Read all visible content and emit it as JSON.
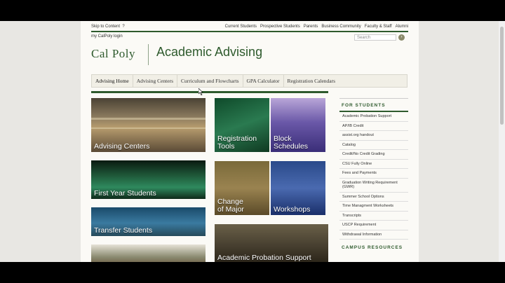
{
  "utility": {
    "skip": "Skip to Content",
    "skip_marker": "?",
    "links": [
      "Current Students",
      "Prospective Students",
      "Parents",
      "Business Community",
      "Faculty & Staff",
      "Alumni"
    ]
  },
  "login": "my CalPoly login",
  "search_placeholder": "Search",
  "logo": "Cal Poly",
  "site_title": "Academic Advising",
  "nav": [
    "Advising Home",
    "Advising Centers",
    "Curriculum and Flowcharts",
    "GPA Calculator",
    "Registration Calendars"
  ],
  "tiles": {
    "advising_centers": "Advising Centers",
    "first_year": "First Year Students",
    "transfer": "Transfer Students",
    "registration_tools_1": "Registration",
    "registration_tools_2": "Tools",
    "block_schedules_1": "Block",
    "block_schedules_2": "Schedules",
    "change_major_1": "Change",
    "change_major_2": "of Major",
    "workshops": "Workshops",
    "probation": "Academic Probation Support"
  },
  "sidebar": {
    "heading": "FOR STUDENTS",
    "items": [
      "Academic Probation Support",
      "AP/IB Credit",
      "assist.org handout",
      "Catalog",
      "Credit/No Credit Grading",
      "CSU Fully Online",
      "Fees and Payments",
      "Graduation Writing Requirement (GWR)",
      "Summer School Options",
      "Time Managment Worksheets",
      "Transcripts",
      "USCP Requirement",
      "Withdrawal Information"
    ],
    "heading2": "CAMPUS RESOURCES"
  },
  "colors": {
    "brand_green": "#2e5a2d",
    "page_bg": "#fbfaf6"
  }
}
